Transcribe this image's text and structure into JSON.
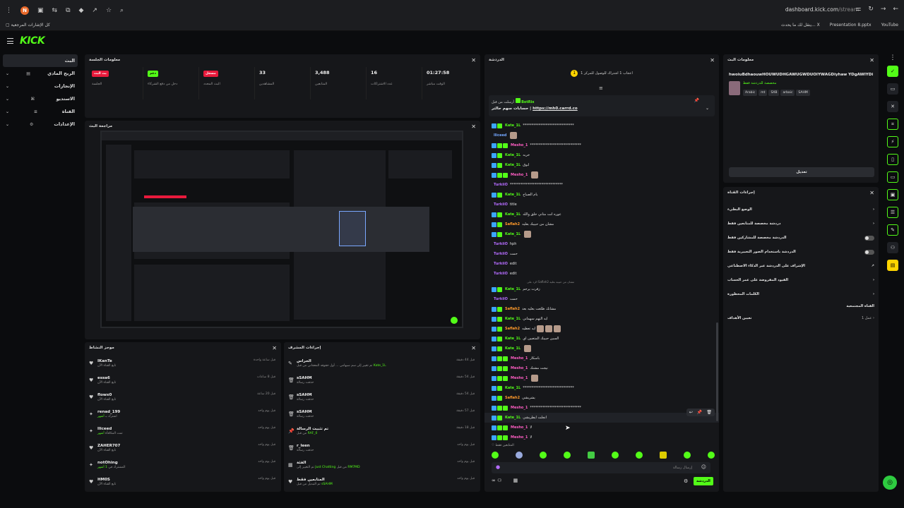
{
  "browser": {
    "profile_initial": "N",
    "url_host": "dashboard.kick.com",
    "url_path": "/stream",
    "bookmarks_left": "كل الإشارات المرجعية",
    "bookmarks_right": [
      "YouTube",
      "Presentation 8.pptx",
      "ينقل لك ما يحدث... X"
    ]
  },
  "header": {
    "logo": "KICK"
  },
  "sidebar": {
    "items": [
      {
        "label": "البث"
      },
      {
        "label": "الربح المادي"
      },
      {
        "label": "الإنجازات"
      },
      {
        "label": "الاستديو"
      },
      {
        "label": "القناة"
      },
      {
        "label": "الإعدادات"
      }
    ]
  },
  "stream_info": {
    "title": "معلومات الجلسة",
    "stats": [
      {
        "badge": "بث البث",
        "badge_color": "red",
        "label": "الجلسة"
      },
      {
        "badge": "دعم",
        "badge_color": "green",
        "label": "دخل من دفع الشركاء"
      },
      {
        "badge": "مسجل",
        "badge_color": "red",
        "label": "البث المحدد"
      },
      {
        "value": "33",
        "label": "المشاهدين"
      },
      {
        "value": "3,488",
        "label": "المتابعين"
      },
      {
        "value": "16",
        "label": "عدد الاشتراكات"
      },
      {
        "value": "01:27:58",
        "label": "الوقت مباشر"
      }
    ]
  },
  "preview": {
    "title": "مراجعة البث"
  },
  "moderators": {
    "title": "موجز النشاط",
    "rows": [
      {
        "icon": "heart",
        "name": "IKanTe",
        "sub": "تابع القناة الآن",
        "time": "قبل ساعة واحدة"
      },
      {
        "icon": "heart",
        "name": "essa6",
        "sub": "تابع القناة الآن",
        "time": "قبل 8 ساعات"
      },
      {
        "icon": "heart",
        "name": "flowx0",
        "sub": "تابع القناة الآن",
        "time": "قبل 20 ساعة"
      },
      {
        "icon": "gift",
        "name": "renad_199",
        "sub_pre": "اشترك بـ",
        "sub_hl": "أشهر",
        "time": "قبل يوم واحد"
      },
      {
        "icon": "gift",
        "name": "lliceed",
        "sub_pre": "تمت المكافأة",
        "sub_hl": "أشهر",
        "time": "قبل يوم واحد"
      },
      {
        "icon": "heart",
        "name": "ZAHER707",
        "sub": "تابع القناة الآن",
        "time": "قبل يوم واحد"
      },
      {
        "icon": "gift",
        "name": "notOhing",
        "sub_pre": "المشترك في",
        "sub_hl": "1 أشهر",
        "time": "قبل يوم واحد"
      },
      {
        "icon": "heart",
        "name": "HM0S",
        "sub": "تابع القناة الآن",
        "time": "قبل يوم واحد"
      }
    ]
  },
  "mod_actions": {
    "title": "إجراءات المشرف",
    "rows": [
      {
        "icon": "edit",
        "name": "الحراس",
        "sub_pre": "تم تغيير إلى سم سيهامي ... أول حقوقه المعجاني من قبل",
        "sub_hl": "Kate_1L",
        "time": "قبل 44 دقيقة"
      },
      {
        "icon": "trash",
        "name": "sSAHM",
        "sub": "حذفت رسالة",
        "time": "قبل 54 دقيقة"
      },
      {
        "icon": "trash",
        "name": "sSAHM",
        "sub": "حذفت رسالة",
        "time": "قبل 54 دقيقة"
      },
      {
        "icon": "trash",
        "name": "sSAHM",
        "sub": "حذفت رسالة",
        "time": "قبل 57 دقيقة"
      },
      {
        "icon": "pin",
        "name": "تم تثبيت الرسالة",
        "sub_pre": "من قبل",
        "sub_hl": "RAF_0",
        "time": "قبل 18 دقيقة"
      },
      {
        "icon": "trash",
        "name": "r_leen",
        "sub": "حذفت رسالة",
        "time": "قبل يوم واحد"
      },
      {
        "icon": "edit",
        "name": "الفئة",
        "sub_pre": "تم التغيير إلى",
        "sub_hl": "Just Chatting",
        "sub_post": "من قبل",
        "sub_hl2": "RM7MD",
        "time": "قبل يوم واحد"
      },
      {
        "icon": "heart",
        "name": "المتابعين فقط",
        "sub_pre": "تم التبديل من قبل",
        "sub_hl": "sSAHM",
        "time": "قبل يوم واحد"
      }
    ]
  },
  "chat": {
    "title": "الدردشة",
    "goal": "اعجاب 1 اشتراك للوصول للمركز 1",
    "pinned_user": "BotRix",
    "pinned_by": "أرسلت من قبل",
    "pinned_text": "حسابات سهم حالتر",
    "pinned_link": "https://mh0.carrd.co",
    "reply_note": "الرد على Saflah2 مشان من حبيبه بعليه",
    "messages": [
      {
        "user": "Kate_1L",
        "color": "green",
        "badges": 2,
        "text": "*****************************"
      },
      {
        "user": "lliceed",
        "color": "blue",
        "badges": 0,
        "text": "",
        "emote": true
      },
      {
        "user": "Mesho_1",
        "color": "pink",
        "badges": 3,
        "text": "*****************************"
      },
      {
        "user": "Kate_1L",
        "color": "green",
        "badges": 2,
        "text": "خربه"
      },
      {
        "user": "Kate_1L",
        "color": "green",
        "badges": 2,
        "text": "ابوق"
      },
      {
        "user": "Mesho_1",
        "color": "pink",
        "badges": 3,
        "text": "",
        "emote": true
      },
      {
        "user": "TurkiiO",
        "color": "purple",
        "badges": 0,
        "text": "******************************"
      },
      {
        "user": "Kate_1L",
        "color": "green",
        "badges": 2,
        "text": "يام الصباح"
      },
      {
        "user": "TurkiiO",
        "color": "purple",
        "badges": 0,
        "text": "title"
      },
      {
        "user": "Kate_1L",
        "color": "green",
        "badges": 2,
        "text": "عوره انت متاني خلق والله"
      },
      {
        "user": "Saflah2",
        "color": "orange",
        "badges": 2,
        "text": "مشان من حبيبك بعليه"
      },
      {
        "user": "Kate_1L",
        "color": "green",
        "badges": 2,
        "text": "",
        "emote": true
      },
      {
        "user": "TurkiiO",
        "color": "purple",
        "badges": 0,
        "text": "hph"
      },
      {
        "user": "TurkiiO",
        "color": "purple",
        "badges": 0,
        "text": "حمت"
      },
      {
        "user": "TurkiiO",
        "color": "purple",
        "badges": 0,
        "text": "edit"
      },
      {
        "user": "TurkiiO",
        "color": "purple",
        "badges": 0,
        "text": "edit"
      },
      {
        "user": "Kate_1L",
        "color": "green",
        "badges": 2,
        "text": "زفرت يرحم"
      },
      {
        "user": "TurkiiO",
        "color": "purple",
        "badges": 0,
        "text": "حمت"
      },
      {
        "user": "Saflah2",
        "color": "orange",
        "badges": 2,
        "text": "مشانك طلعت بعليه بعد"
      },
      {
        "user": "Kate_1L",
        "color": "green",
        "badges": 2,
        "text": "ايه النهم سهماني"
      },
      {
        "user": "Saflah2",
        "color": "orange",
        "badges": 2,
        "text": "ايه تعطيه",
        "emote": true
      },
      {
        "user": "Kate_1L",
        "color": "green",
        "badges": 2,
        "text": "السين حبيبك المتعبين اي"
      },
      {
        "user": "Kate_1L",
        "color": "green",
        "badges": 2,
        "text": "",
        "emote": true
      },
      {
        "user": "Mesho_1",
        "color": "pink",
        "badges": 3,
        "text": "باسكار"
      },
      {
        "user": "Mesho_1",
        "color": "pink",
        "badges": 3,
        "text": "نيجت مشنك"
      },
      {
        "user": "Mesho_1",
        "color": "pink",
        "badges": 3,
        "text": "",
        "emote": true
      },
      {
        "user": "Kate_1L",
        "color": "green",
        "badges": 2,
        "text": "*****************************"
      },
      {
        "user": "Saflah2",
        "color": "orange",
        "badges": 2,
        "text": "يشريشي"
      },
      {
        "user": "Mesho_1",
        "color": "pink",
        "badges": 3,
        "text": "*****************************"
      },
      {
        "user": "Kate_1L",
        "color": "green",
        "badges": 2,
        "text": "انجلت ايطريشي"
      },
      {
        "user": "Mesho_1",
        "color": "pink",
        "badges": 3,
        "text": "لا"
      },
      {
        "user": "Mesho_1",
        "color": "pink",
        "badges": 3,
        "text": "لا"
      }
    ],
    "viewers_label": "المتابعين فقط",
    "input_placeholder": "إرسال رسالة",
    "send_label": "الدردشة"
  },
  "stream_meta": {
    "title": "معلومات البث",
    "stream_title": "hwoiuBdhaouwHOUWUDHGAWUGWDUOIYWAGDiyhaw YDgAWIYDi",
    "category_label": "مخصصة للدردشة فقط",
    "tags": [
      "Arabic",
      "mt",
      "SXB",
      "arbaic",
      "SAHM"
    ],
    "edit_label": "تعديل"
  },
  "mod_tools": {
    "title": "إجراءات القناة",
    "rows": [
      {
        "label": "الوضع البطيء",
        "ctrl": "chev"
      },
      {
        "label": "دردشة مخصصة للمتابعين فقط",
        "ctrl": "chev"
      },
      {
        "label": "الدردشة مخصصة للمشاركين فقط",
        "ctrl": "toggle"
      },
      {
        "label": "الدردشة باستخدام الصور التعبيرية فقط",
        "ctrl": "toggle"
      },
      {
        "label": "الإشراف على الدردشة عبر الذكاء الاصطناعي",
        "ctrl": "ext"
      },
      {
        "label": "القيود المفروضة على عمر الحساب",
        "ctrl": "chev"
      },
      {
        "label": "الكلمات المحظورة",
        "ctrl": "chev"
      }
    ],
    "section": "القناة المجتمعية",
    "target_label": "تعيين الأهداف",
    "target_value": "عمل 1"
  }
}
